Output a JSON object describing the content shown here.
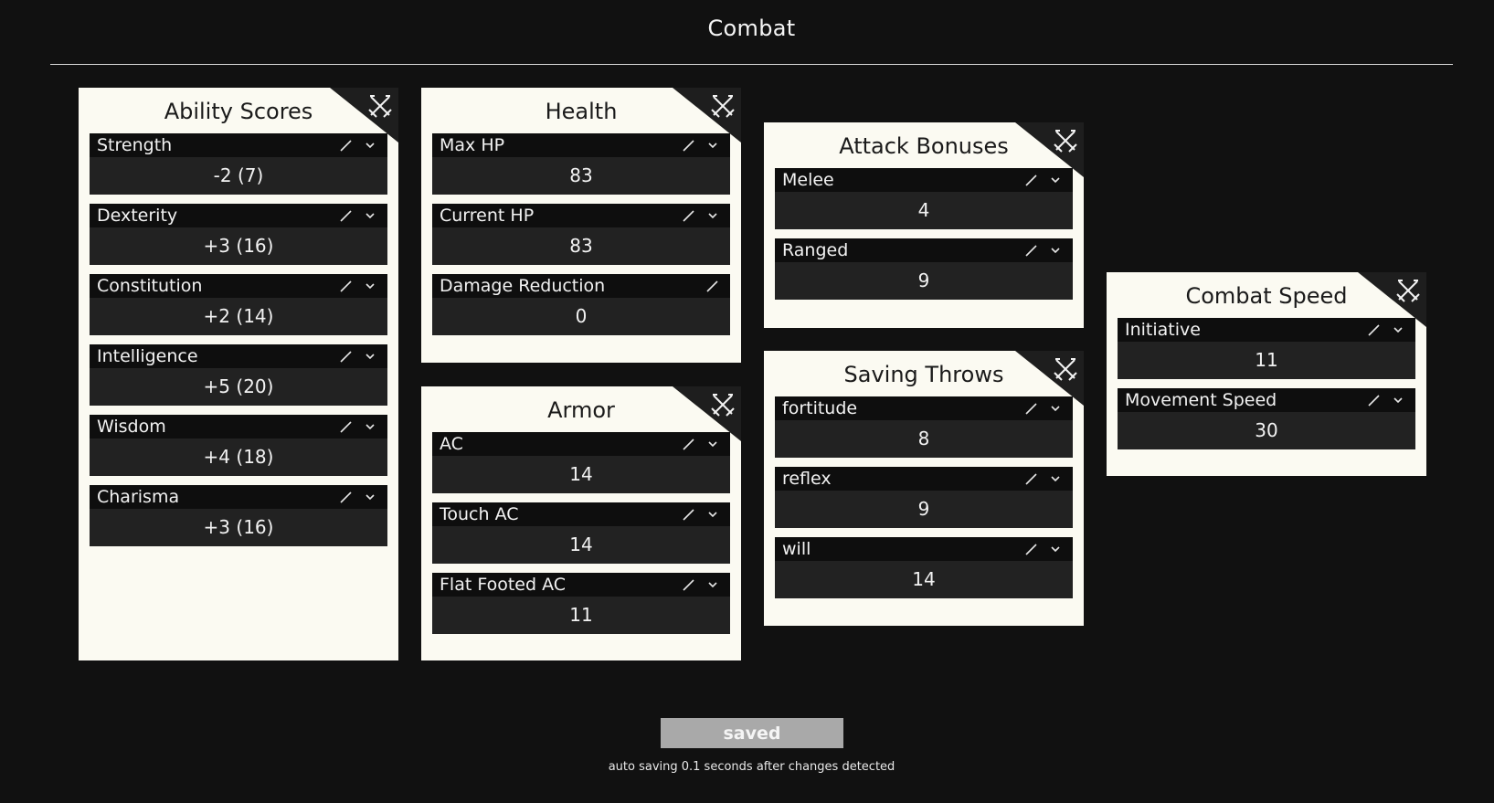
{
  "header": {
    "title": "Combat"
  },
  "cards": {
    "ability_scores": {
      "title": "Ability Scores",
      "stats": [
        {
          "label": "Strength",
          "value": "-2 (7)"
        },
        {
          "label": "Dexterity",
          "value": "+3 (16)"
        },
        {
          "label": "Constitution",
          "value": "+2 (14)"
        },
        {
          "label": "Intelligence",
          "value": "+5 (20)"
        },
        {
          "label": "Wisdom",
          "value": "+4 (18)"
        },
        {
          "label": "Charisma",
          "value": "+3 (16)"
        }
      ]
    },
    "health": {
      "title": "Health",
      "stats": [
        {
          "label": "Max HP",
          "value": "83"
        },
        {
          "label": "Current HP",
          "value": "83"
        },
        {
          "label": "Damage Reduction",
          "value": "0"
        }
      ]
    },
    "armor": {
      "title": "Armor",
      "stats": [
        {
          "label": "AC",
          "value": "14"
        },
        {
          "label": "Touch AC",
          "value": "14"
        },
        {
          "label": "Flat Footed AC",
          "value": "11"
        }
      ]
    },
    "attack_bonuses": {
      "title": "Attack Bonuses",
      "stats": [
        {
          "label": "Melee",
          "value": "4"
        },
        {
          "label": "Ranged",
          "value": "9"
        }
      ]
    },
    "saving_throws": {
      "title": "Saving Throws",
      "stats": [
        {
          "label": "fortitude",
          "value": "8"
        },
        {
          "label": "reflex",
          "value": "9"
        },
        {
          "label": "will",
          "value": "14"
        }
      ]
    },
    "combat_speed": {
      "title": "Combat Speed",
      "stats": [
        {
          "label": "Initiative",
          "value": "11"
        },
        {
          "label": "Movement Speed",
          "value": "30"
        }
      ]
    }
  },
  "footer": {
    "save_label": "saved",
    "autosave_note": "auto saving 0.1 seconds after changes detected"
  },
  "icons": {
    "card_corner": "crossed-swords-icon",
    "edit": "pencil-icon",
    "expand": "chevron-down-icon"
  },
  "colors": {
    "background": "#111111",
    "card": "#fbfaf2",
    "stat_header": "#0e0e0e",
    "stat_value": "#222222",
    "save_button": "#a9a9a9"
  }
}
